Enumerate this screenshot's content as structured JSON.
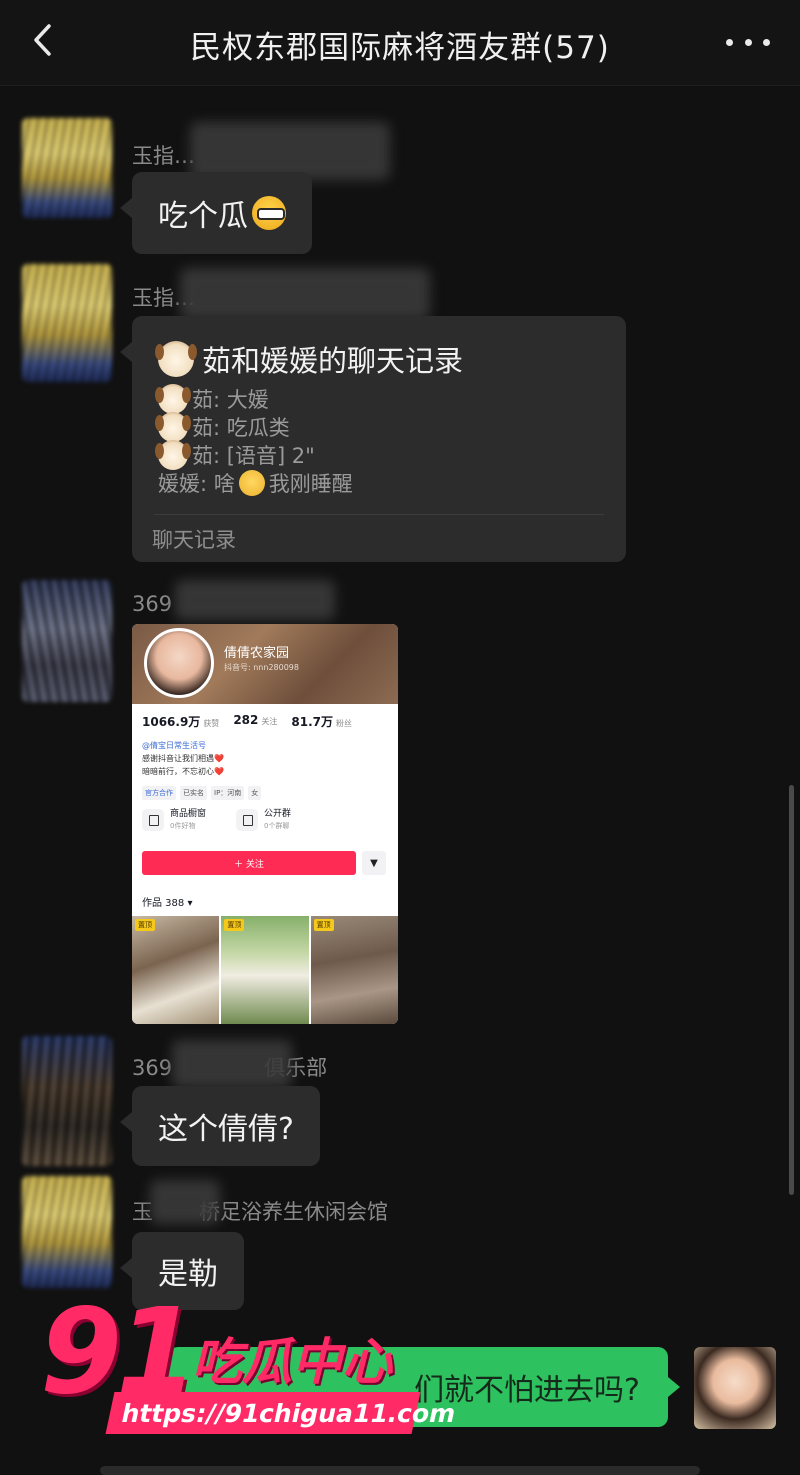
{
  "header": {
    "title": "民权东郡国际麻将酒友群(57)"
  },
  "icons": {
    "back": "chevron-left-icon",
    "more": "more-dots-icon"
  },
  "messages": [
    {
      "sender": "玉指…",
      "text": "吃个瓜"
    },
    {
      "sender": "玉指…",
      "record": {
        "title": "茹和媛媛的聊天记录",
        "lines": [
          "茹: 大媛",
          "茹: 吃瓜类",
          "茹: [语音] 2\""
        ],
        "line4_a": "媛媛: 啥",
        "line4_b": "我刚睡醒",
        "footer": "聊天记录"
      }
    },
    {
      "sender": "369",
      "profile": {
        "name": "倩倩农家园",
        "id": "抖音号: nnn280098",
        "likes": "1066.9万",
        "likes_label": "获赞",
        "following": "282",
        "following_label": "关注",
        "fans": "81.7万",
        "fans_label": "粉丝",
        "bio_handle": "@倩宝日常生活号",
        "bio1": "感谢抖音让我们相遇❤️",
        "bio2": "暗暗前行，不忘初心❤️",
        "tags": [
          "官方合作",
          "已实名",
          "IP：河南",
          "女"
        ],
        "shop_title": "商品橱窗",
        "shop_sub": "0件好物",
        "group_title": "公开群",
        "group_sub": "0个群聊",
        "follow_label": "＋ 关注",
        "works": "作品 388 ▾",
        "pin_label": "置顶"
      }
    },
    {
      "sender_a": "369",
      "sender_b": "俱乐部",
      "text": "这个倩倩?"
    },
    {
      "sender_a": "玉",
      "sender_b": "桥足浴养生休闲会馆",
      "text": "是勒"
    },
    {
      "text": "们就不怕进去吗?"
    }
  ],
  "watermark": {
    "number": "91",
    "brand": "吃瓜中心",
    "url": "https://91chigua11.com"
  },
  "colors": {
    "background": "#111111",
    "bubble": "#2c2c2c",
    "my_bubble": "#2dc15f",
    "watermark": "#ff2a66",
    "follow_button": "#fe2c55"
  }
}
